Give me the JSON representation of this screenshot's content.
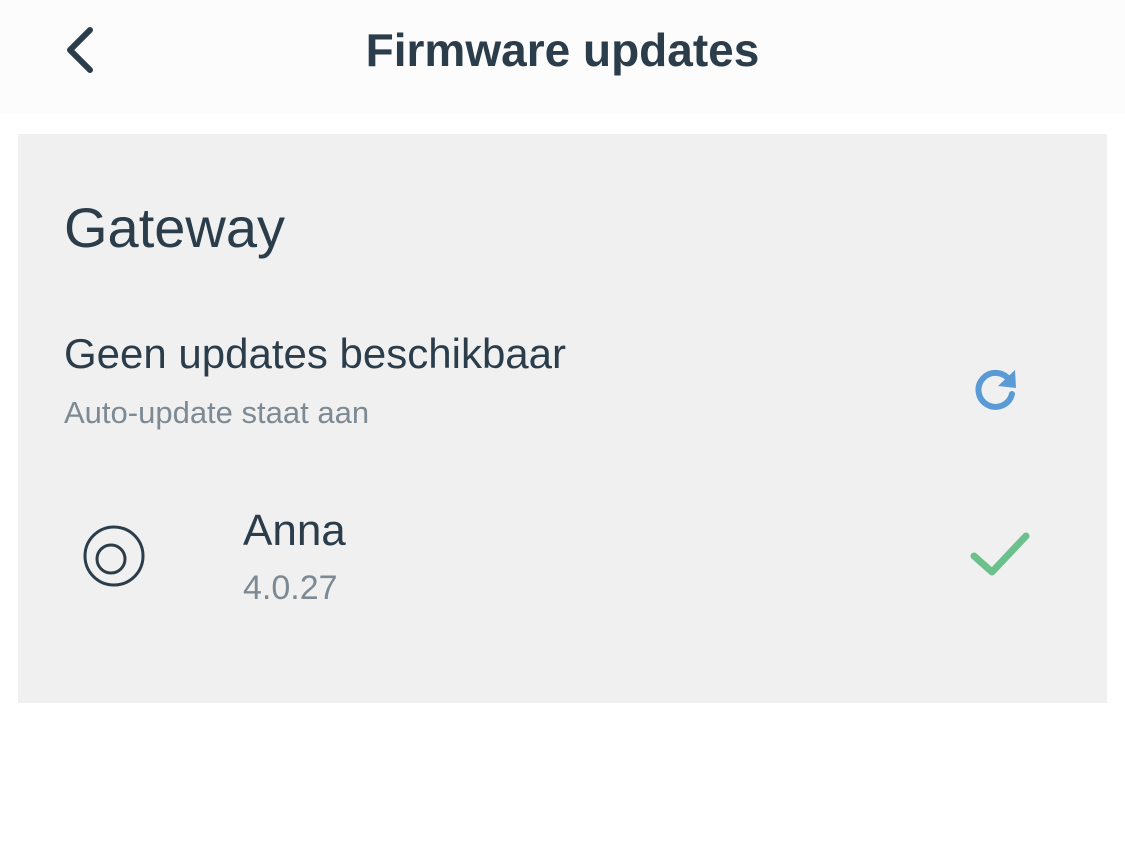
{
  "header": {
    "title": "Firmware updates",
    "back_icon": "chevron-left-icon"
  },
  "gateway": {
    "section_title": "Gateway",
    "status": {
      "title": "Geen updates beschikbaar",
      "subtitle": "Auto-update staat aan",
      "refresh_icon": "refresh-icon",
      "refresh_color": "#5b9bd5"
    },
    "devices": [
      {
        "name": "Anna",
        "version": "4.0.27",
        "icon": "thermostat-icon",
        "status_icon": "check-icon",
        "status_color": "#6cc08b"
      }
    ]
  },
  "colors": {
    "text_primary": "#2b3d4a",
    "text_secondary": "#7d8a93",
    "card_background": "#f0f0f0"
  }
}
